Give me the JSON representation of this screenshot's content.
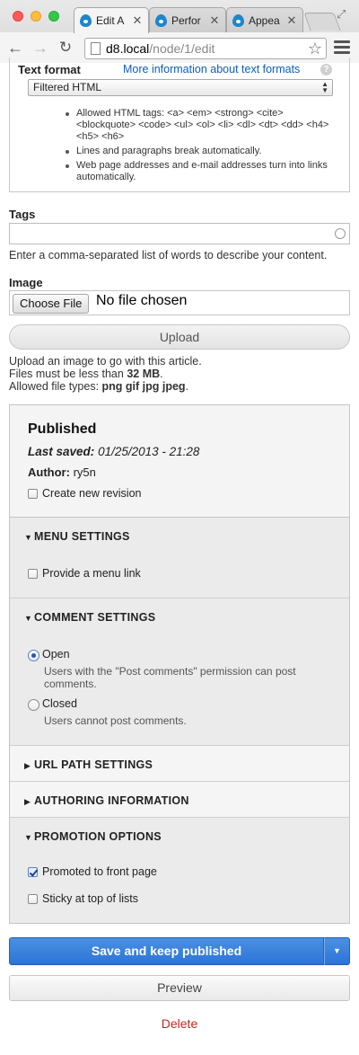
{
  "browser": {
    "tabs": [
      {
        "label": "Edit A",
        "active": true
      },
      {
        "label": "Perfor",
        "active": false
      },
      {
        "label": "Appea",
        "active": false
      }
    ],
    "close_glyph": "✕",
    "url_host": "d8.local",
    "url_path": "/node/1/edit"
  },
  "text_format": {
    "label": "Text format",
    "help_link": "More information about text formats",
    "help_icon": "?",
    "selected": "Filtered HTML",
    "tips": [
      "Allowed HTML tags: <a> <em> <strong> <cite> <blockquote> <code> <ul> <ol> <li> <dl> <dt> <dd> <h4> <h5> <h6>",
      "Lines and paragraphs break automatically.",
      "Web page addresses and e-mail addresses turn into links automatically."
    ]
  },
  "tags": {
    "label": "Tags",
    "value": "",
    "description": "Enter a comma-separated list of words to describe your content."
  },
  "image": {
    "label": "Image",
    "choose_button": "Choose File",
    "no_file": "No file chosen",
    "upload_button": "Upload",
    "description_line1": "Upload an image to go with this article.",
    "size_prefix": "Files must be less than ",
    "size_value": "32 MB",
    "size_suffix": ".",
    "types_prefix": "Allowed file types: ",
    "types_value": "png gif jpg jpeg",
    "types_suffix": "."
  },
  "meta": {
    "status": "Published",
    "last_saved_label": "Last saved:",
    "last_saved_value": "01/25/2013 - 21:28",
    "author_label": "Author:",
    "author_value": "ry5n",
    "new_revision_label": "Create new revision",
    "new_revision_checked": false
  },
  "sections": {
    "menu": {
      "title": "MENU SETTINGS",
      "open": true,
      "provide_link_label": "Provide a menu link",
      "provide_link_checked": false
    },
    "comment": {
      "title": "COMMENT SETTINGS",
      "open": true,
      "options": [
        {
          "label": "Open",
          "description": "Users with the \"Post comments\" permission can post comments.",
          "checked": true
        },
        {
          "label": "Closed",
          "description": "Users cannot post comments.",
          "checked": false
        }
      ]
    },
    "url_path": {
      "title": "URL PATH SETTINGS",
      "open": false
    },
    "authoring": {
      "title": "AUTHORING INFORMATION",
      "open": false
    },
    "promotion": {
      "title": "PROMOTION OPTIONS",
      "open": true,
      "promoted_label": "Promoted to front page",
      "promoted_checked": true,
      "sticky_label": "Sticky at top of lists",
      "sticky_checked": false
    }
  },
  "actions": {
    "save": "Save and keep published",
    "preview": "Preview",
    "delete": "Delete"
  },
  "colors": {
    "primary": "#2c74d8",
    "link": "#0a5fbf",
    "danger": "#c3261c"
  }
}
